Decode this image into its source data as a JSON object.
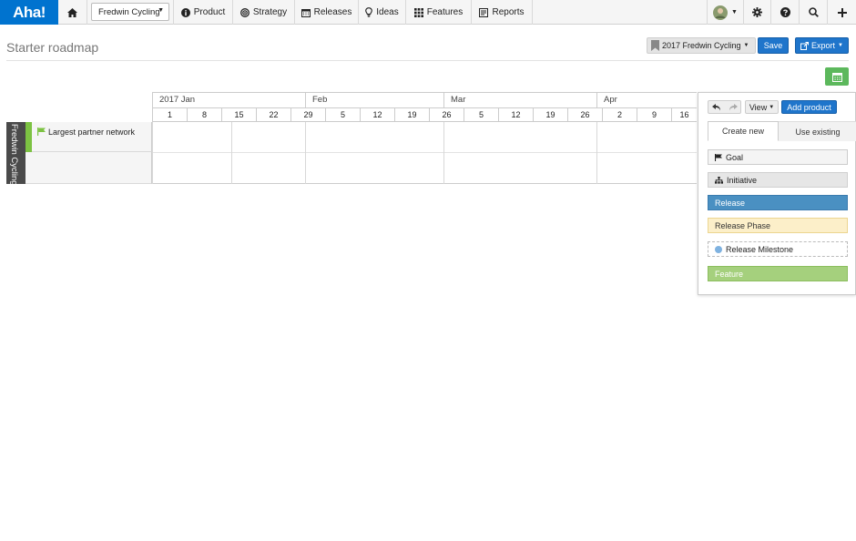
{
  "brand": {
    "logo_text": "Aha!"
  },
  "nav": {
    "product_selector": "Fredwin Cycling",
    "items": [
      {
        "label": "Product"
      },
      {
        "label": "Strategy"
      },
      {
        "label": "Releases"
      },
      {
        "label": "Ideas"
      },
      {
        "label": "Features"
      },
      {
        "label": "Reports"
      }
    ]
  },
  "page": {
    "title": "Starter roadmap",
    "roadmap_selector": "2017 Fredwin Cycling",
    "save_label": "Save",
    "export_label": "Export"
  },
  "timeline": {
    "months": [
      "2017 Jan",
      "Feb",
      "Mar",
      "Apr"
    ],
    "days": [
      "1",
      "8",
      "15",
      "22",
      "29",
      "5",
      "12",
      "19",
      "26",
      "5",
      "12",
      "19",
      "26",
      "2",
      "9",
      "16"
    ]
  },
  "rows": {
    "product_label": "Fredwin Cycling",
    "goal_label": "Largest partner network"
  },
  "panel": {
    "view_label": "View",
    "add_product_label": "Add product",
    "tab_create": "Create new",
    "tab_existing": "Use existing",
    "tiles": {
      "goal": "Goal",
      "initiative": "Initiative",
      "release": "Release",
      "release_phase": "Release Phase",
      "release_milestone": "Release Milestone",
      "feature": "Feature"
    }
  },
  "colors": {
    "brand_blue": "#0073cf",
    "goal_green": "#7cc242",
    "release_blue": "#4a90c2",
    "phase_yellow": "#fcefc9",
    "feature_green": "#a5d07d",
    "calendar_green": "#5cb85c"
  }
}
